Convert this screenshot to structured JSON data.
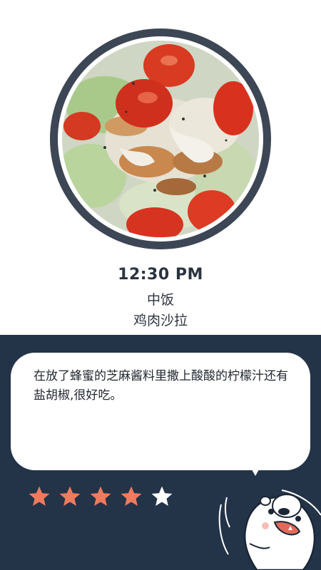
{
  "meal": {
    "time": "12:30 PM",
    "type": "中饭",
    "dish": "鸡肉沙拉"
  },
  "note": {
    "text": "在放了蜂蜜的芝麻酱料里撒上酸酸的柠檬汁还有盐胡椒,很好吃。"
  },
  "rating": {
    "value": 4,
    "max": 5
  },
  "colors": {
    "panel": "#233348",
    "ring": "#3d4654",
    "star_filled": "#ef7b5f",
    "star_empty": "#ffffff"
  }
}
